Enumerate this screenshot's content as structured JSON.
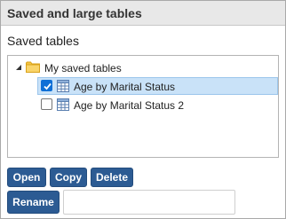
{
  "panel": {
    "title": "Saved and large tables"
  },
  "saved_tables": {
    "section_title": "Saved tables",
    "root": {
      "label": "My saved tables",
      "icon": "folder-icon",
      "expanded": true
    },
    "items": [
      {
        "label": "Age by Marital Status",
        "checked": true,
        "selected": true,
        "icon": "table-icon"
      },
      {
        "label": "Age by Marital Status 2",
        "checked": false,
        "selected": false,
        "icon": "table-icon"
      }
    ]
  },
  "actions": {
    "open_label": "Open",
    "copy_label": "Copy",
    "delete_label": "Delete",
    "rename_label": "Rename",
    "rename_value": "",
    "rename_placeholder": ""
  },
  "colors": {
    "button_bg": "#2c5b93",
    "selection_bg": "#c9e2f8",
    "folder": "#f5c542",
    "checkbox_checked": "#0f6fd6"
  }
}
